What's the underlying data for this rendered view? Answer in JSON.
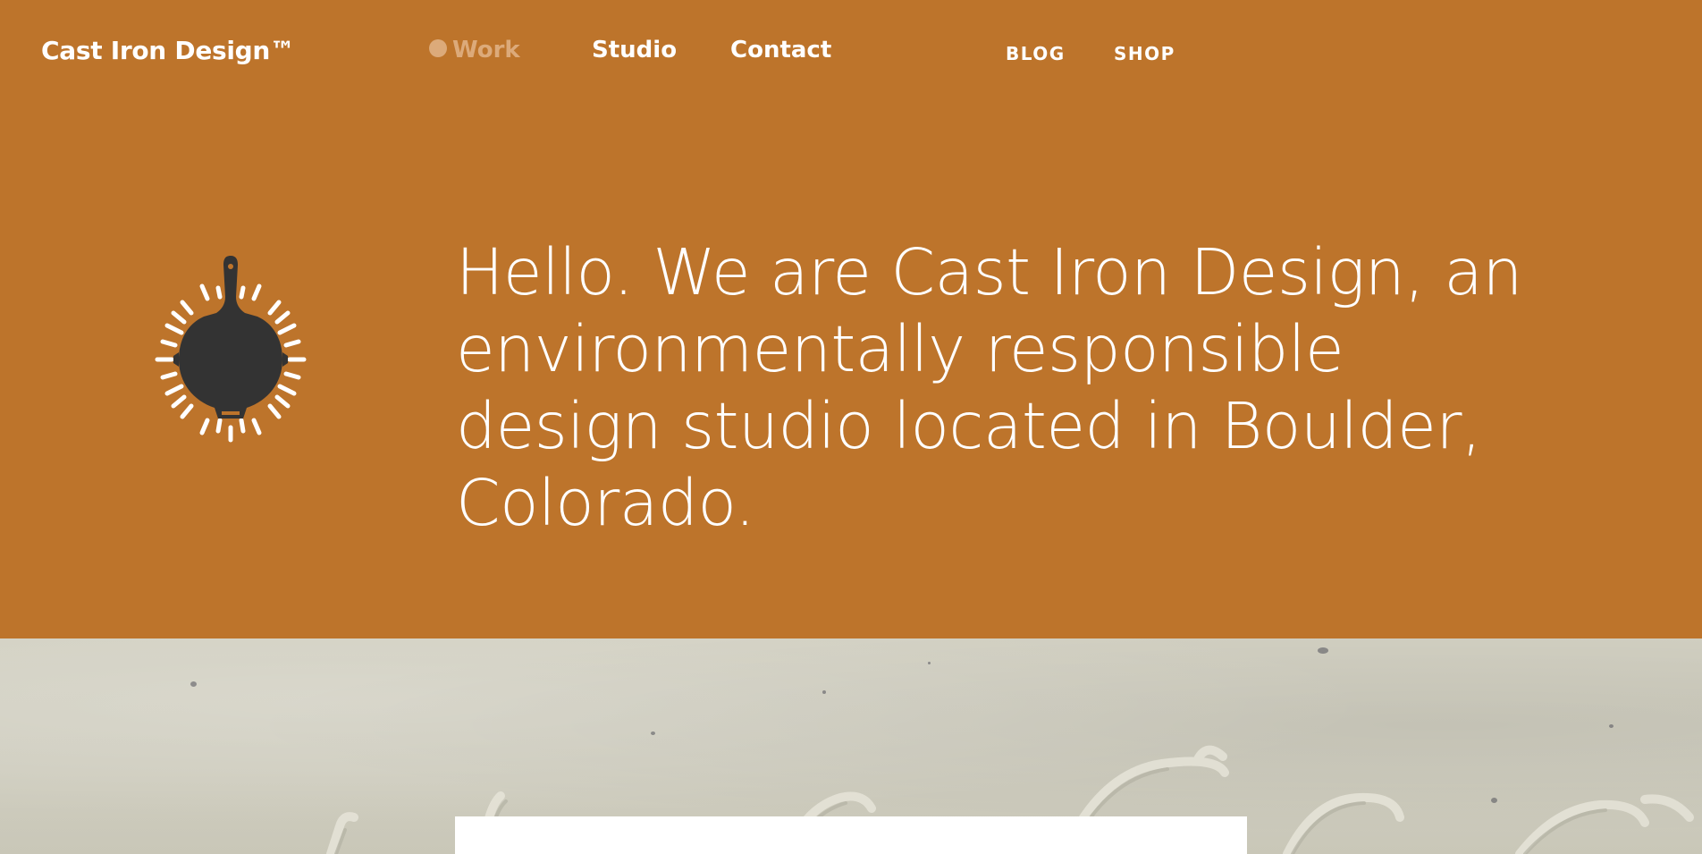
{
  "header": {
    "brand": "Cast Iron Design™",
    "nav": {
      "work": "Work",
      "studio": "Studio",
      "contact": "Contact"
    },
    "secondary_nav": {
      "blog": "BLOG",
      "shop": "SHOP"
    }
  },
  "hero": {
    "logo_icon": "skillet-sunburst-icon",
    "headline": "Hello. We are Cast Iron Design, an environmentally responsible design studio located in Boulder, Colorado."
  },
  "colors": {
    "brand_orange": "#bd742b",
    "active_nav": "#dcaa7a",
    "skillet": "#333333",
    "paper": "#d0cec0"
  }
}
